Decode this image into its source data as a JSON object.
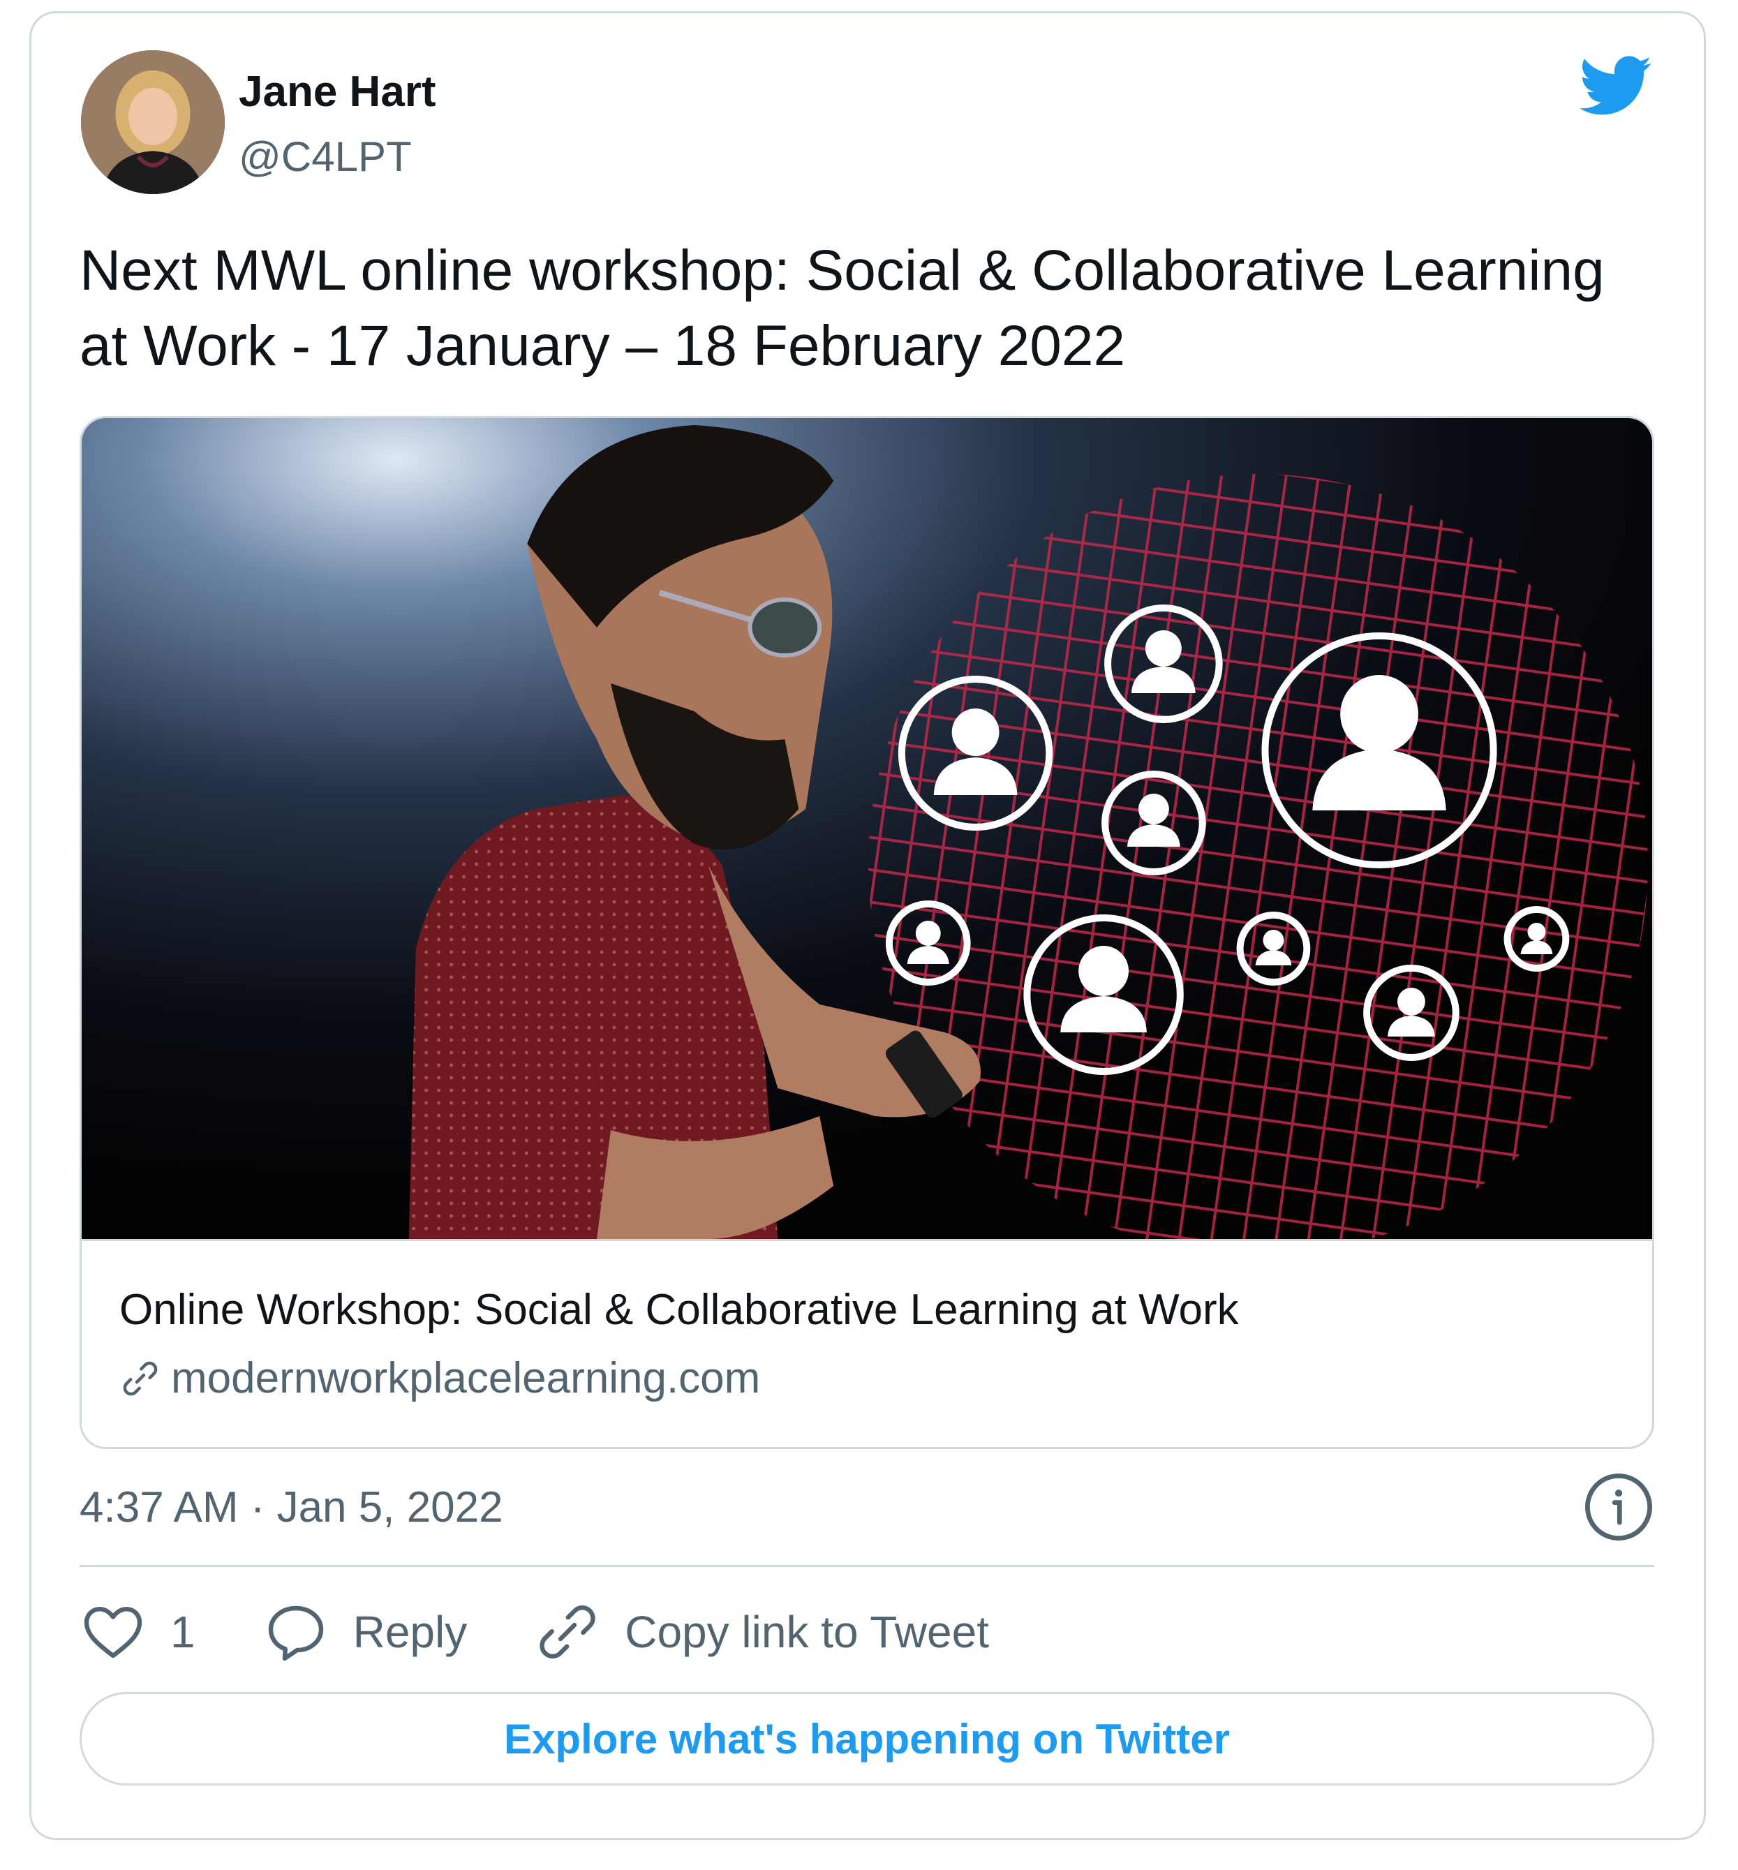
{
  "author": {
    "name": "Jane Hart",
    "handle": "@C4LPT",
    "avatar_icon": "profile-photo"
  },
  "brand": {
    "logo_icon": "twitter-bird-icon",
    "accent_color": "#1d9bf0"
  },
  "tweet": {
    "text": "Next MWL online workshop: Social & Collaborative Learning at Work - 17 January – 18 February 2022",
    "timestamp": "4:37 AM · Jan 5, 2022"
  },
  "link_card": {
    "title": "Online Workshop: Social & Collaborative Learning at Work",
    "domain": "modernworkplacelearning.com",
    "domain_icon": "link-icon"
  },
  "actions": {
    "like_count": "1",
    "reply_label": "Reply",
    "copy_link_label": "Copy link to Tweet"
  },
  "explore": {
    "label": "Explore what's happening on Twitter"
  },
  "colors": {
    "text_primary": "#0f1419",
    "text_secondary": "#536471",
    "border": "#cfd9de"
  }
}
